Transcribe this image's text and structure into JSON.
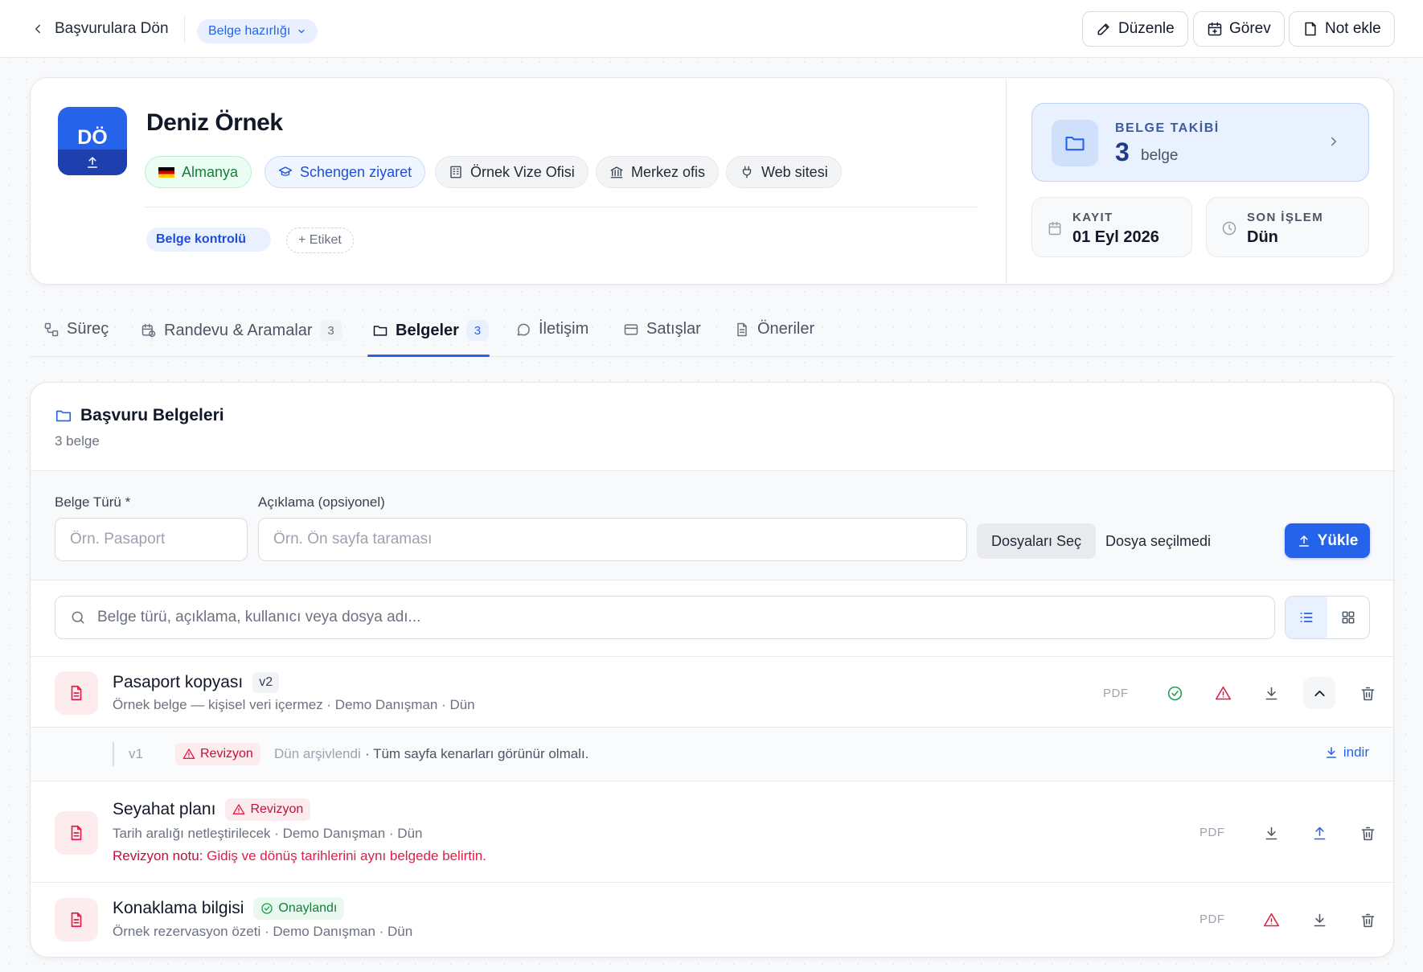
{
  "topbar": {
    "back_label": "Başvurulara Dön",
    "status": "Belge hazırlığı",
    "edit_label": "Düzenle",
    "task_label": "Görev",
    "note_label": "Not ekle"
  },
  "profile": {
    "initials": "DÖ",
    "name": "Deniz Örnek",
    "chips": {
      "country": "Almanya",
      "visa_type": "Schengen ziyaret",
      "office": "Örnek Vize Ofisi",
      "branch": "Merkez ofis",
      "source": "Web sitesi"
    },
    "tag": "Belge kontrolü",
    "add_tag_label": "+ Etiket"
  },
  "tracking": {
    "label": "BELGE TAKİBİ",
    "count": "3",
    "unit": "belge"
  },
  "stats": {
    "registered_label": "KAYIT",
    "registered_value": "01 Eyl 2026",
    "last_action_label": "SON İŞLEM",
    "last_action_value": "Dün"
  },
  "tabs": {
    "process": "Süreç",
    "appointments": "Randevu & Aramalar",
    "appointments_count": "3",
    "documents": "Belgeler",
    "documents_count": "3",
    "communication": "İletişim",
    "sales": "Satışlar",
    "suggestions": "Öneriler"
  },
  "documents": {
    "title": "Başvuru Belgeleri",
    "subtitle": "3 belge",
    "upload": {
      "type_label": "Belge Türü *",
      "type_placeholder": "Örn. Pasaport",
      "desc_label": "Açıklama (opsiyonel)",
      "desc_placeholder": "Örn. Ön sayfa taraması",
      "choose_label": "Dosyaları Seç",
      "no_file": "Dosya seçilmedi",
      "upload_label": "Yükle"
    },
    "search_placeholder": "Belge türü, açıklama, kullanıcı veya dosya adı...",
    "items": [
      {
        "name": "Pasaport kopyası",
        "version": "v2",
        "meta": "Örnek belge — kişisel veri içermez · Demo Danışman · Dün",
        "format": "PDF",
        "history": {
          "version": "v1",
          "status": "Revizyon",
          "date": "Dün arşivlendi",
          "note": "· Tüm sayfa kenarları görünür olmalı.",
          "download_label": "indir"
        }
      },
      {
        "name": "Seyahat planı",
        "status": "Revizyon",
        "meta": "Tarih aralığı netleştirilecek · Demo Danışman · Dün",
        "note_label": "Revizyon notu:",
        "note": " Gidiş ve dönüş tarihlerini aynı belgede belirtin.",
        "format": "PDF"
      },
      {
        "name": "Konaklama bilgisi",
        "status": "Onaylandı",
        "meta": "Örnek rezervasyon özeti · Demo Danışman · Dün",
        "format": "PDF"
      }
    ]
  },
  "colors": {
    "accent": "#2563eb",
    "danger": "#e11d48",
    "success": "#16a34a"
  }
}
